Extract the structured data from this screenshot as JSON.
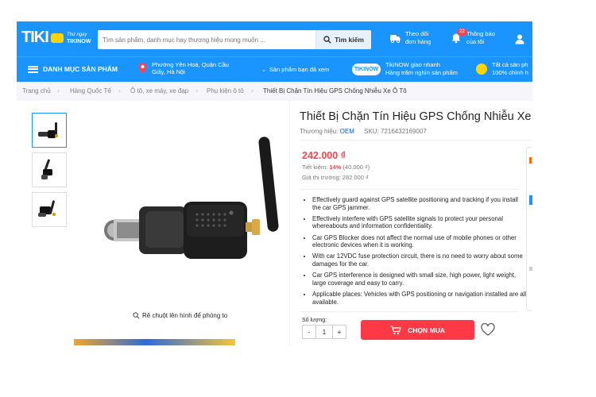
{
  "header": {
    "logo": "TIKI",
    "now_badge_line1": "Thứ ngay",
    "now_badge_line2": "TIKINOW",
    "search_placeholder": "Tìm sản phẩm, danh mục hay thương hiệu mong muốn ...",
    "search_button": "Tìm kiếm",
    "orders_line1": "Theo dõi",
    "orders_line2": "đơn hàng",
    "notif_line1": "Thông báo",
    "notif_line2": "của tôi",
    "notif_count": "22"
  },
  "nav": {
    "category": "DANH MỤC SẢN PHẨM",
    "location_line1": "Phường Yên Hoà, Quận Cầu",
    "location_line2": "Giấy, Hà Nội",
    "seen": "Sản phẩm bạn đã xem",
    "tikinow_pill": "TIKINOW",
    "now_line1": "TikiNOW giao nhanh",
    "now_line2": "Hàng trăm nghìn sản phẩm",
    "genuine_line1": "Tất cả sản ph",
    "genuine_line2": "100% chính h"
  },
  "breadcrumb": [
    "Trang chủ",
    "Hàng Quốc Tế",
    "Ô tô, xe máy, xe đạp",
    "Phụ kiện ô tô",
    "Thiết Bị Chặn Tín Hiệu GPS Chống Nhiễu Xe Ô Tô"
  ],
  "product": {
    "title": "Thiết Bị Chặn Tín Hiệu GPS Chống Nhiễu Xe",
    "brand_label": "Thương hiệu:",
    "brand": "OEM",
    "sku": "SKU: 7216432169007",
    "price": "242.000 ₫",
    "saving_label": "Tiết kiệm:",
    "saving_percent": "14%",
    "saving_amount": "(40.000 ₫)",
    "market_price": "Giá thị trường: 282.000 ₫",
    "zoom_hint": "Rê chuột lên hình để phóng to",
    "features": [
      "Effectively guard against GPS satellite positioning and tracking if you install the car GPS jammer.",
      "Effectively interfere with GPS satellite signals to protect your personal whereabouts and information confidentiality.",
      "Car GPS Blocker does not affect the normal use of mobile phones or other electronic devices when it is working.",
      "With car 12VDC fuse protection circuit, there is no need to worry about some damages for the car.",
      "Car GPS interference is designed with small size, high power, light weight, large coverage and easy to carry.",
      "Applicable places: Vehicles with GPS positioning or navigation installed are all available."
    ],
    "qty_label": "Số lượng:",
    "qty_minus": "-",
    "qty_value": "1",
    "qty_plus": "+",
    "buy_button": "CHỌN MUA"
  },
  "colors": {
    "primary": "#1a94ff",
    "price": "#ff424e",
    "buy": "#ff3945",
    "link": "#0d5cb6"
  }
}
